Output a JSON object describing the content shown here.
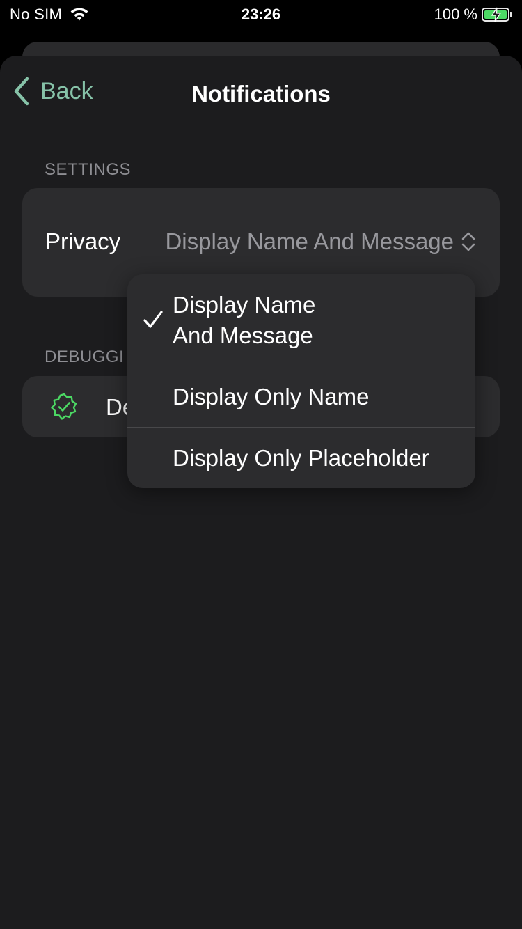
{
  "status_bar": {
    "carrier": "No SIM",
    "time": "23:26",
    "battery_percent": "100 %"
  },
  "nav": {
    "back_label": "Back",
    "title": "Notifications"
  },
  "settings_section": {
    "header": "SETTINGS",
    "privacy_label": "Privacy",
    "privacy_value": "Display Name And Message"
  },
  "debug_section": {
    "header": "DEBUGGI",
    "row_label": "De"
  },
  "dropdown": {
    "options": [
      {
        "line1": "Display Name",
        "line2": "And Message",
        "selected": true
      },
      {
        "line1": "Display Only Name",
        "selected": false
      },
      {
        "line1": "Display Only Placeholder",
        "selected": false
      }
    ]
  },
  "colors": {
    "accent": "#86c2a8",
    "sheet_background": "#1c1c1e",
    "card_background": "#2c2c2e",
    "secondary_text": "#98989d",
    "success_green": "#4cd964"
  },
  "icons": [
    "wifi-icon",
    "battery-icon",
    "chevron-left-icon",
    "chevron-updown-icon",
    "checkmark-icon",
    "verified-badge-icon"
  ]
}
